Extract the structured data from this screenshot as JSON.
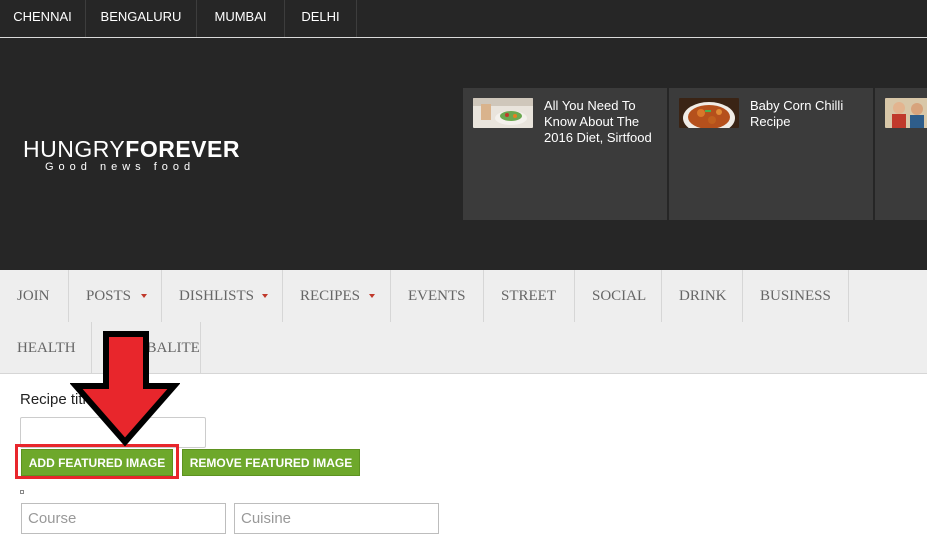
{
  "cities": [
    "CHENNAI",
    "BENGALURU",
    "MUMBAI",
    "DELHI"
  ],
  "logo": {
    "word1": "HUNGRY",
    "word2": "FOREVER",
    "tagline": "Good news food"
  },
  "featured": [
    {
      "title": "All You Need To Know About The 2016 Diet, Sirtfood",
      "thumb": "salad-photo-icon"
    },
    {
      "title": "Baby Corn Chilli Recipe",
      "thumb": "chilli-dish-photo-icon"
    },
    {
      "title": "",
      "thumb": "people-photo-icon"
    }
  ],
  "nav": {
    "items": [
      {
        "label": "JOIN"
      },
      {
        "label": "POSTS"
      },
      {
        "label": "DISHLISTS"
      },
      {
        "label": "RECIPES"
      },
      {
        "label": "EVENTS"
      },
      {
        "label": "STREET"
      },
      {
        "label": "SOCIAL"
      },
      {
        "label": "DRINK"
      },
      {
        "label": "BUSINESS"
      },
      {
        "label": "HEALTH"
      },
      {
        "label": "CELEBALITE"
      }
    ]
  },
  "form": {
    "recipe_title_label": "Recipe title",
    "recipe_title_value": "",
    "add_featured_image": "ADD FEATURED IMAGE",
    "remove_featured_image": "REMOVE FEATURED IMAGE",
    "course_placeholder": "Course",
    "cuisine_placeholder": "Cuisine"
  },
  "colors": {
    "header_bg": "#262626",
    "nav_bg": "#eeeeee",
    "button_green": "#6ea82b",
    "highlight_red": "#e8262c"
  }
}
